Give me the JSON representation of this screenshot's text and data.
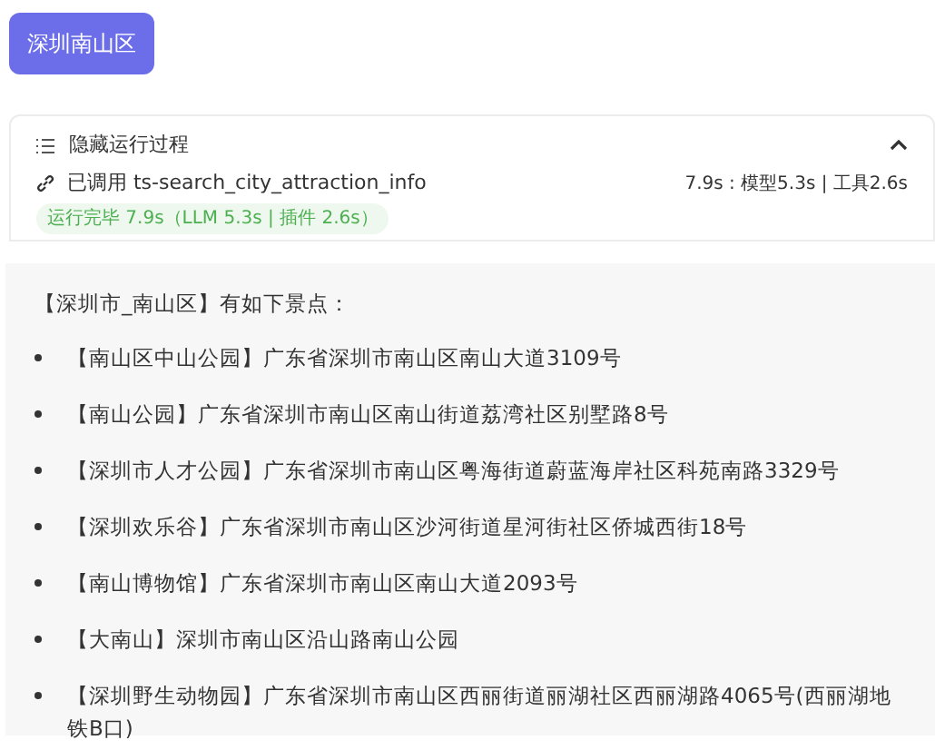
{
  "query_button": "深圳南山区",
  "process": {
    "toggle_label": "隐藏运行过程",
    "expanded": true,
    "call_label": "已调用 ts-search_city_attraction_info",
    "timing": "7.9s : 模型5.3s | 工具2.6s",
    "status": "运行完毕 7.9s（LLM 5.3s | 插件 2.6s）"
  },
  "answer": {
    "intro": "【深圳市_南山区】有如下景点：",
    "items": [
      "【南山区中山公园】广东省深圳市南山区南山大道3109号",
      "【南山公园】广东省深圳市南山区南山街道荔湾社区别墅路8号",
      "【深圳市人才公园】广东省深圳市南山区粤海街道蔚蓝海岸社区科苑南路3329号",
      "【深圳欢乐谷】广东省深圳市南山区沙河街道星河街社区侨城西街18号",
      "【南山博物馆】广东省深圳市南山区南山大道2093号",
      "【大南山】深圳市南山区沿山路南山公园",
      "【深圳野生动物园】广东省深圳市南山区西丽街道丽湖社区西丽湖路4065号(西丽湖地铁B口)"
    ]
  }
}
